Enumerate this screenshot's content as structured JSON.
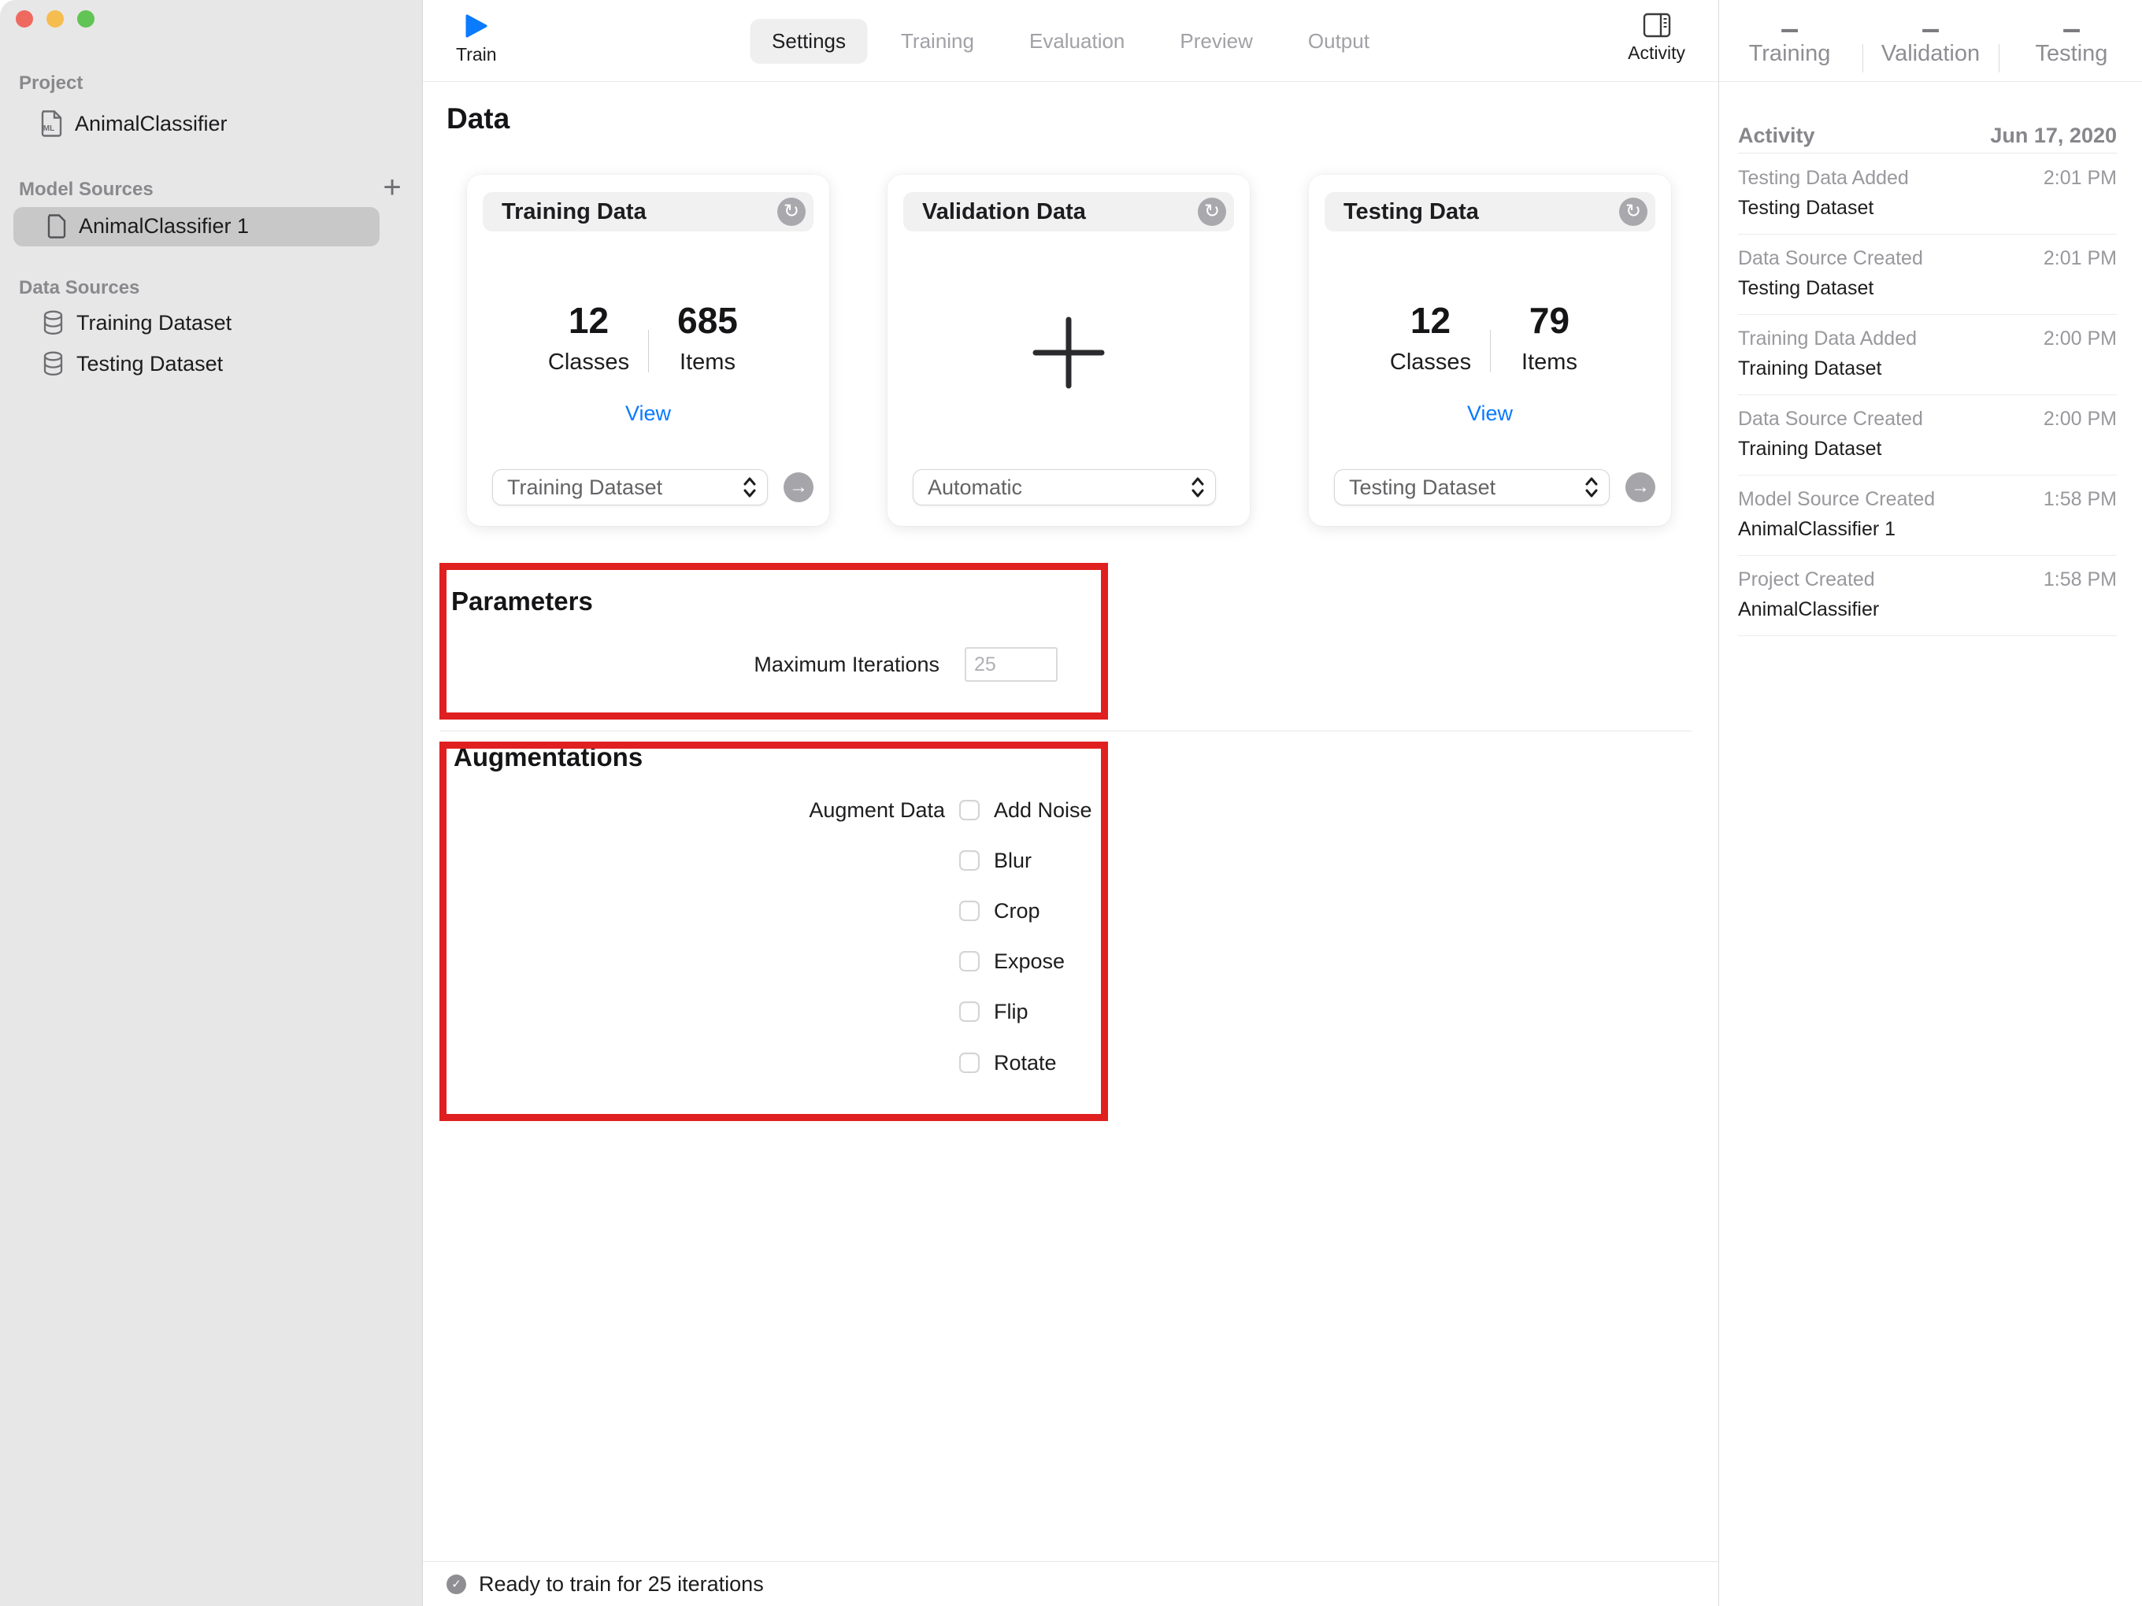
{
  "colors": {
    "accent_blue": "#0a7aff",
    "highlight_red": "#e02020",
    "traffic_red": "#ee6a5f",
    "traffic_yellow": "#f5bd4f",
    "traffic_green": "#61c454"
  },
  "sidebar": {
    "project_header": "Project",
    "project_item": "AnimalClassifier",
    "model_sources_header": "Model Sources",
    "add_model_source": "+",
    "model_source_item": "AnimalClassifier 1",
    "data_sources_header": "Data Sources",
    "data_source_1": "Training Dataset",
    "data_source_2": "Testing Dataset"
  },
  "toolbar": {
    "train_label": "Train",
    "tabs": [
      {
        "label": "Settings"
      },
      {
        "label": "Training"
      },
      {
        "label": "Evaluation"
      },
      {
        "label": "Preview"
      },
      {
        "label": "Output"
      }
    ],
    "activity_label": "Activity"
  },
  "main": {
    "title": "Data",
    "cards": {
      "training": {
        "title": "Training Data",
        "refresh_icon": "↻",
        "classes_value": "12",
        "classes_label": "Classes",
        "items_value": "685",
        "items_label": "Items",
        "view_label": "View",
        "dropdown_value": "Training Dataset",
        "arrow_icon": "→"
      },
      "validation": {
        "title": "Validation Data",
        "refresh_icon": "↻",
        "dropdown_value": "Automatic"
      },
      "testing": {
        "title": "Testing Data",
        "refresh_icon": "↻",
        "classes_value": "12",
        "classes_label": "Classes",
        "items_value": "79",
        "items_label": "Items",
        "view_label": "View",
        "dropdown_value": "Testing Dataset",
        "arrow_icon": "→"
      }
    },
    "parameters": {
      "title": "Parameters",
      "max_iterations_label": "Maximum Iterations",
      "max_iterations_value": "25"
    },
    "augmentations": {
      "title": "Augmentations",
      "augment_label": "Augment Data",
      "options": [
        "Add Noise",
        "Blur",
        "Crop",
        "Expose",
        "Flip",
        "Rotate"
      ]
    },
    "status_text": "Ready to train for 25 iterations",
    "status_icon": "✓"
  },
  "right_panel": {
    "stats": [
      {
        "value": "–",
        "label": "Training"
      },
      {
        "value": "–",
        "label": "Validation"
      },
      {
        "value": "–",
        "label": "Testing"
      }
    ],
    "activity_header": "Activity",
    "activity_date": "Jun 17, 2020",
    "activity_rows": [
      {
        "title": "Testing Data Added",
        "time": "2:01 PM",
        "subtitle": "Testing Dataset"
      },
      {
        "title": "Data Source Created",
        "time": "2:01 PM",
        "subtitle": "Testing Dataset"
      },
      {
        "title": "Training Data Added",
        "time": "2:00 PM",
        "subtitle": "Training Dataset"
      },
      {
        "title": "Data Source Created",
        "time": "2:00 PM",
        "subtitle": "Training Dataset"
      },
      {
        "title": "Model Source Created",
        "time": "1:58 PM",
        "subtitle": "AnimalClassifier 1"
      },
      {
        "title": "Project Created",
        "time": "1:58 PM",
        "subtitle": "AnimalClassifier"
      }
    ]
  }
}
